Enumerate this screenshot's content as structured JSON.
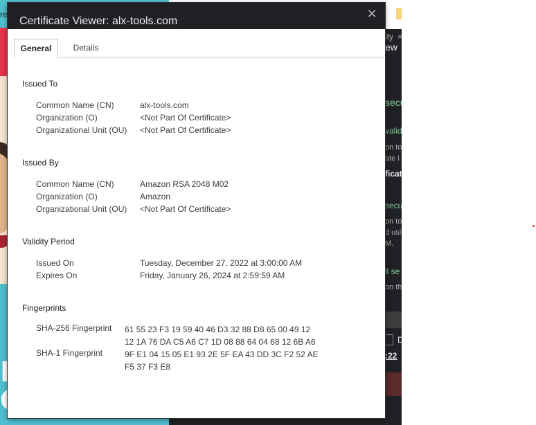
{
  "background": {
    "left_partial_text": "re",
    "left_glyphs": [
      "M",
      "C"
    ],
    "right_fragments": [
      "ity",
      "×",
      "ew",
      "secu",
      "valid",
      "on to",
      "ate i",
      "ficat",
      "secu",
      "on to",
      "d usi",
      "M.",
      "ll se",
      "on th",
      "D",
      ":22"
    ]
  },
  "dialog": {
    "title": "Certificate Viewer: alx-tools.com",
    "close_label": "×",
    "tabs": [
      {
        "label": "General",
        "active": true
      },
      {
        "label": "Details",
        "active": false
      }
    ],
    "issued_to": {
      "title": "Issued To",
      "rows": [
        {
          "key": "Common Name (CN)",
          "value": "alx-tools.com"
        },
        {
          "key": "Organization (O)",
          "value": "<Not Part Of Certificate>"
        },
        {
          "key": "Organizational Unit (OU)",
          "value": "<Not Part Of Certificate>"
        }
      ]
    },
    "issued_by": {
      "title": "Issued By",
      "rows": [
        {
          "key": "Common Name (CN)",
          "value": "Amazon RSA 2048 M02"
        },
        {
          "key": "Organization (O)",
          "value": "Amazon"
        },
        {
          "key": "Organizational Unit (OU)",
          "value": "<Not Part Of Certificate>"
        }
      ]
    },
    "validity": {
      "title": "Validity Period",
      "rows": [
        {
          "key": "Issued On",
          "value": "Tuesday, December 27, 2022 at 3:00:00 AM"
        },
        {
          "key": "Expires On",
          "value": "Friday, January 26, 2024 at 2:59:59 AM"
        }
      ]
    },
    "fingerprints": {
      "title": "Fingerprints",
      "rows": [
        {
          "key": "SHA-256 Fingerprint",
          "lines": [
            "61 55 23 F3 19 59 40 46 D3 32 88 D8 65 00 49 12",
            "12 1A 76 DA C5 A6 C7 1D 08 88 64 04 68 12 6B A6"
          ]
        },
        {
          "key": "SHA-1 Fingerprint",
          "lines": [
            "9F E1 04 15 05 E1 93 2E 5F EA 43 DD 3C F2 52 AE",
            "F5 37 F3 E8"
          ]
        }
      ]
    }
  },
  "colors": {
    "titlebar": "#202124",
    "accent_green": "#81c995"
  }
}
